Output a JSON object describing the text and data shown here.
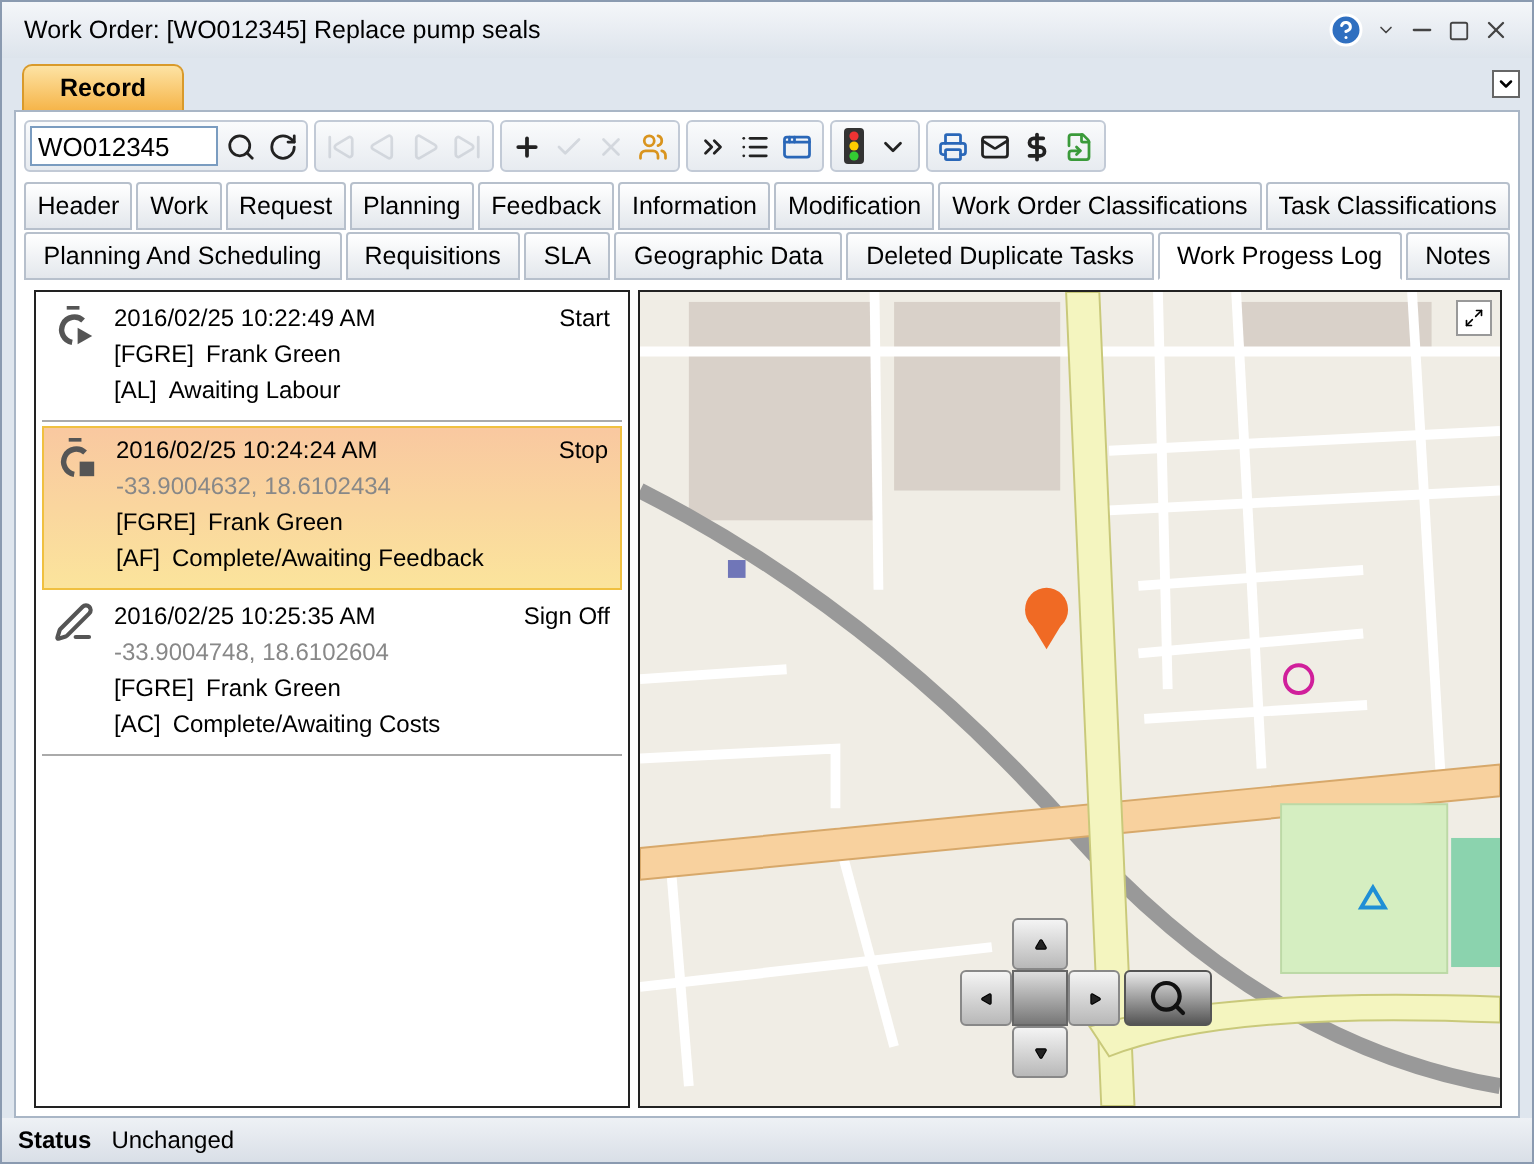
{
  "window": {
    "title": "Work Order: [WO012345] Replace pump seals"
  },
  "ribbon_tabs": [
    {
      "label": "Record",
      "selected": true
    }
  ],
  "toolbar": {
    "record_field": {
      "value": "WO012345"
    },
    "groups": [
      [
        {
          "kind": "search",
          "disabled": false
        },
        {
          "kind": "refresh",
          "disabled": false
        }
      ],
      [
        {
          "kind": "first",
          "disabled": true
        },
        {
          "kind": "previous",
          "disabled": true
        },
        {
          "kind": "next",
          "disabled": true
        },
        {
          "kind": "last",
          "disabled": true
        }
      ],
      [
        {
          "kind": "add",
          "disabled": false
        },
        {
          "kind": "save",
          "disabled": true
        },
        {
          "kind": "cancel",
          "disabled": true
        },
        {
          "kind": "people",
          "disabled": false
        }
      ],
      [
        {
          "kind": "more",
          "disabled": false
        },
        {
          "kind": "list",
          "disabled": false
        },
        {
          "kind": "window",
          "disabled": false
        }
      ],
      [
        {
          "kind": "status",
          "disabled": false
        },
        {
          "kind": "dropdown",
          "disabled": false
        }
      ],
      [
        {
          "kind": "print",
          "disabled": false
        },
        {
          "kind": "mail",
          "disabled": false
        },
        {
          "kind": "costs",
          "disabled": false
        },
        {
          "kind": "export",
          "disabled": false
        }
      ]
    ]
  },
  "tab_rows": [
    [
      {
        "label": "Header",
        "selected": false
      },
      {
        "label": "Work",
        "selected": false
      },
      {
        "label": "Request",
        "selected": false
      },
      {
        "label": "Planning",
        "selected": false
      },
      {
        "label": "Feedback",
        "selected": false
      },
      {
        "label": "Information",
        "selected": false
      },
      {
        "label": "Modification",
        "selected": false
      },
      {
        "label": "Work Order Classifications",
        "selected": false
      },
      {
        "label": "Task Classifications",
        "selected": false
      }
    ],
    [
      {
        "label": "Planning And Scheduling",
        "selected": false
      },
      {
        "label": "Requisitions",
        "selected": false
      },
      {
        "label": "SLA",
        "selected": false
      },
      {
        "label": "Geographic Data",
        "selected": false
      },
      {
        "label": "Deleted Duplicate Tasks",
        "selected": false
      },
      {
        "label": "Work Progess Log",
        "selected": true
      },
      {
        "label": "Notes",
        "selected": false
      }
    ]
  ],
  "log_entries": [
    {
      "kind": "start",
      "selected": false,
      "timestamp": "2016/02/25 10:22:49 AM",
      "action": "Start",
      "employee_code": "[FGRE]",
      "employee": "Frank Green",
      "status_code": "[AL]",
      "status": "Awaiting Labour"
    },
    {
      "kind": "stop",
      "selected": true,
      "timestamp": "2016/02/25 10:24:24 AM",
      "action": "Stop",
      "coordinates": "-33.9004632, 18.6102434",
      "employee_code": "[FGRE]",
      "employee": "Frank Green",
      "status_code": "[AF]",
      "status": "Complete/Awaiting Feedback"
    },
    {
      "kind": "sign_off",
      "selected": false,
      "timestamp": "2016/02/25 10:25:35 AM",
      "action": "Sign Off",
      "coordinates": "-33.9004748, 18.6102604",
      "employee_code": "[FGRE]",
      "employee": "Frank Green",
      "status_code": "[AC]",
      "status": "Complete/Awaiting Costs"
    }
  ],
  "status_bar": {
    "label": "Status",
    "value": "Unchanged"
  }
}
